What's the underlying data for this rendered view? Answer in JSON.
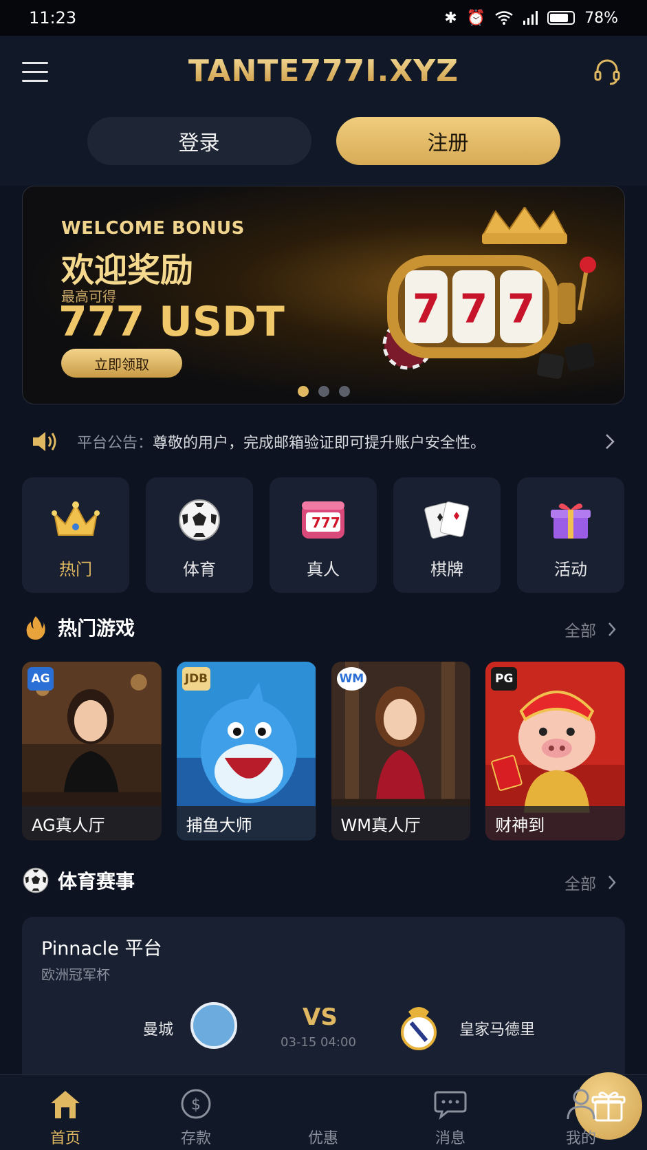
{
  "status_bar": {
    "time": "11:23",
    "battery": "78%"
  },
  "header": {
    "logo": "TANTE777I.XYZ",
    "login_label": "登录",
    "register_label": "注册"
  },
  "banner": {
    "welcome_en": "WELCOME BONUS",
    "welcome_cn": "欢迎奖励",
    "max_label": "最高可得",
    "amount": "777 USDT",
    "claim_label": "立即领取",
    "slot_digits": [
      "7",
      "7",
      "7"
    ],
    "active_slide": 1,
    "slides": 3
  },
  "notice": {
    "label": "平台公告：",
    "message": "尊敬的用户，完成邮箱验证即可提升账户安全性。"
  },
  "categories": [
    {
      "label": "热门",
      "icon": "crown-icon",
      "active": true
    },
    {
      "label": "体育",
      "icon": "soccer-ball-icon",
      "active": false
    },
    {
      "label": "真人",
      "icon": "slot-machine-icon",
      "active": false
    },
    {
      "label": "棋牌",
      "icon": "playing-cards-icon",
      "active": false
    },
    {
      "label": "活动",
      "icon": "gift-icon",
      "active": false
    }
  ],
  "hot_games": {
    "title": "热门游戏",
    "all_label": "全部",
    "items": [
      {
        "name": "AG真人厅",
        "badge": "AG"
      },
      {
        "name": "捕鱼大师",
        "badge": "JDB"
      },
      {
        "name": "WM真人厅",
        "badge": "WM"
      },
      {
        "name": "财神到",
        "badge": "PG"
      }
    ]
  },
  "sports": {
    "title": "体育赛事",
    "all_label": "全部",
    "platform": "Pinnacle 平台",
    "league": "欧洲冠军杯",
    "home_team": "曼城",
    "away_team": "皇家马德里",
    "vs_label": "VS",
    "match_time": "03-15 04:00"
  },
  "bottom_nav": [
    {
      "label": "首页",
      "icon": "home-icon",
      "active": true
    },
    {
      "label": "存款",
      "icon": "dollar-icon",
      "active": false
    },
    {
      "label": "优惠",
      "icon": "gift-icon",
      "active": false
    },
    {
      "label": "消息",
      "icon": "chat-icon",
      "active": false
    },
    {
      "label": "我的",
      "icon": "user-icon",
      "active": false
    }
  ],
  "colors": {
    "accent": "#e0b862",
    "background": "#0d1320",
    "card": "#182031"
  }
}
